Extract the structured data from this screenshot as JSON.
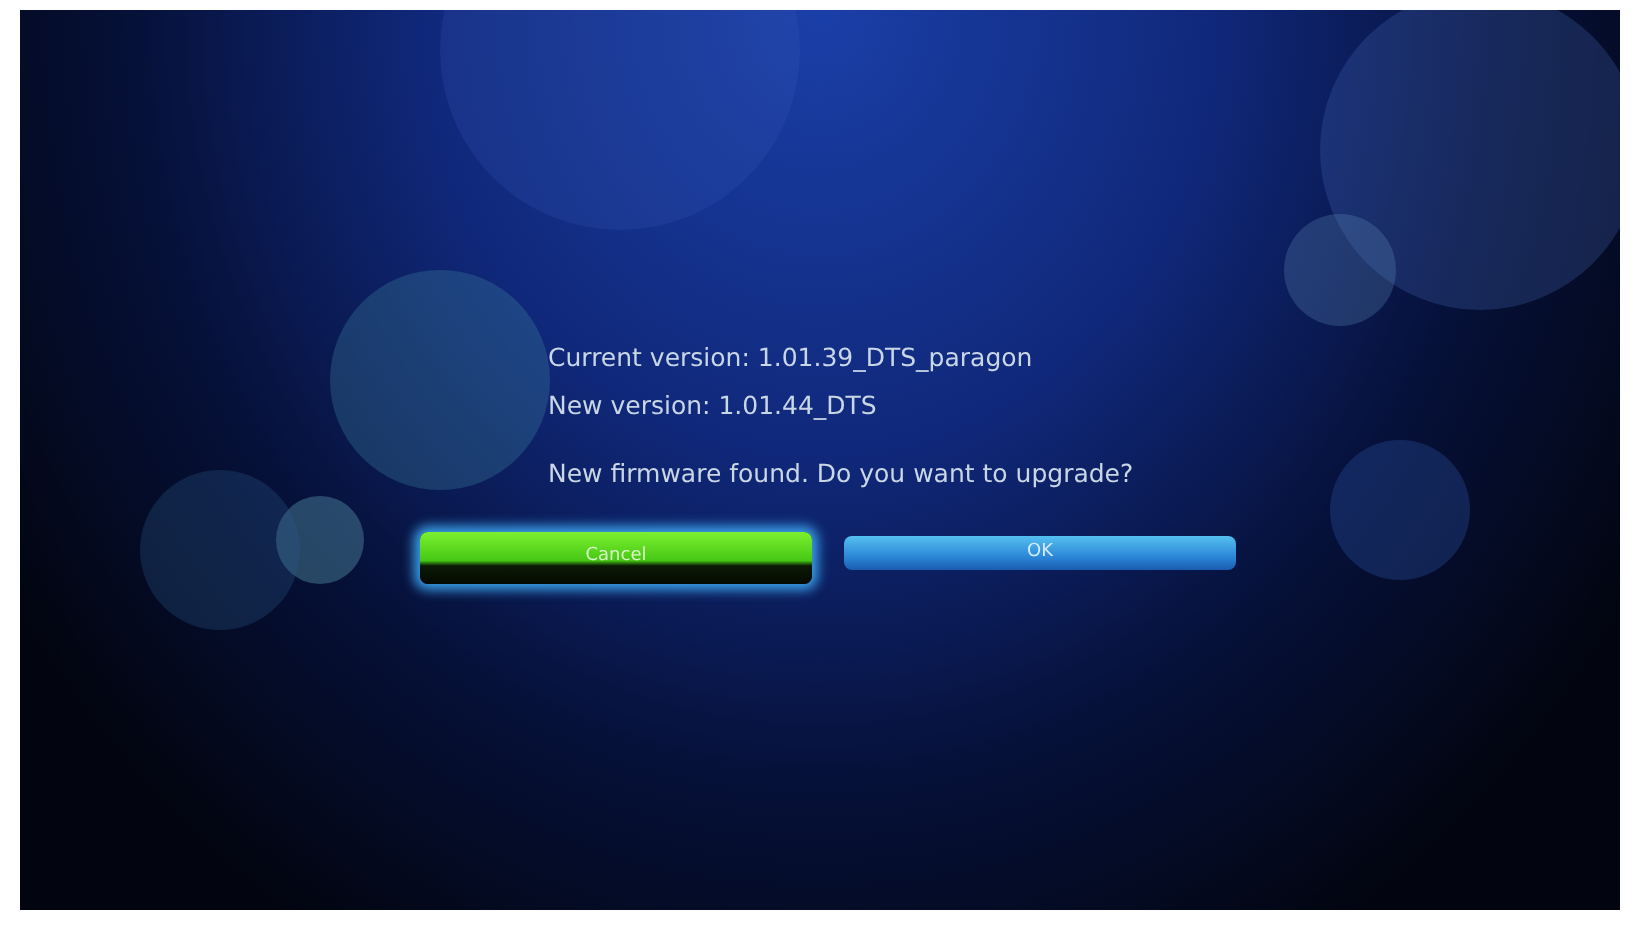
{
  "dialog": {
    "lines": [
      "Current version: 1.01.39_DTS_paragon",
      "New version: 1.01.44_DTS"
    ],
    "message": "New firmware found. Do you want to upgrade?",
    "buttons": [
      {
        "label": "Cancel",
        "selected": true
      },
      {
        "label": "OK",
        "selected": false
      }
    ]
  }
}
